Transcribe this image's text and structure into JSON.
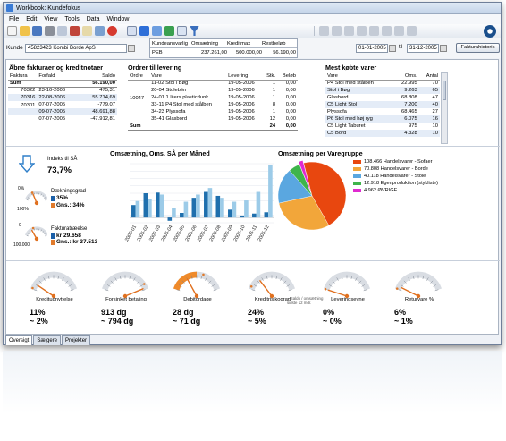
{
  "window": {
    "title": "Workbook: Kundefokus"
  },
  "menu": [
    "File",
    "Edit",
    "View",
    "Tools",
    "Data",
    "Window"
  ],
  "filter": {
    "kunde_label": "Kunde",
    "kunde_value": "45823423 Kombi Borde ApS",
    "date_from": "01-01-2005",
    "date_to_label": "til",
    "date_to": "31-12-2005",
    "history_button": "Fakturahistorik"
  },
  "kpi_strip": {
    "headers": [
      "Kundeansvarlig",
      "Omsætning",
      "Kreditmax",
      "Restbeløb"
    ],
    "values": [
      "PEB",
      "237.261,00",
      "500.000,00",
      "56.190,00"
    ]
  },
  "open_invoices": {
    "title": "Åbne fakturaer og kreditnotaer",
    "columns": [
      "Faktura",
      "Forfald",
      "Saldo"
    ],
    "sum_label": "Sum",
    "sum_value": "56.190,00",
    "rows": [
      [
        "70322",
        "23-10-2006",
        "475,31"
      ],
      [
        "70316",
        "22-08-2006",
        "55.714,69"
      ],
      [
        "70301",
        "07-07-2005",
        "-779,07"
      ],
      [
        "",
        "09-07-2005",
        "48.691,88"
      ],
      [
        "",
        "07-07-2005",
        "-47.912,81"
      ]
    ]
  },
  "orders": {
    "title": "Ordrer til levering",
    "columns": [
      "Ordre",
      "Vare",
      "Levering",
      "Stk.",
      "Beløb"
    ],
    "order_no": "10047",
    "rows": [
      [
        "11-02",
        "Stol i Bøg",
        "19-05-2006",
        "1",
        "0,00"
      ],
      [
        "20-04",
        "Stolebén",
        "19-05-2006",
        "1",
        "0,00"
      ],
      [
        "24-01",
        "1 liters plasticdunk",
        "19-05-2006",
        "1",
        "0,00"
      ],
      [
        "33-11",
        "P4 Stol med stålben",
        "19-05-2006",
        "8",
        "0,00"
      ],
      [
        "34-23",
        "Plyssofa",
        "19-05-2006",
        "1",
        "0,00"
      ],
      [
        "35-41",
        "Glasbord",
        "19-05-2006",
        "12",
        "0,00"
      ]
    ],
    "sum_label": "Sum",
    "sum_qty": "24",
    "sum_amount": "0,00"
  },
  "top_items": {
    "title": "Mest købte varer",
    "columns": [
      "Vare",
      "Oms.",
      "Antal"
    ],
    "rows": [
      [
        "P4 Stol med stålben",
        "22.995",
        "70"
      ],
      [
        "Stol i Bøg",
        "9.263",
        "65"
      ],
      [
        "Glasbord",
        "68.808",
        "47"
      ],
      [
        "C5 Light Stol",
        "7.200",
        "40"
      ],
      [
        "Plyssofa",
        "68.465",
        "27"
      ],
      [
        "P6 Stol med høj ryg",
        "6.075",
        "16"
      ],
      [
        "C5 Light Taburet",
        "975",
        "10"
      ],
      [
        "C5 Bord",
        "4.328",
        "10"
      ]
    ]
  },
  "index": {
    "label": "Indeks til SÅ",
    "value": "73,7%"
  },
  "coverage": {
    "title": "Dækningsgrad",
    "value1": "35%",
    "value2": "Gns.: 34%",
    "scale_min": "0%",
    "scale_max": "100%",
    "fraction": 0.35,
    "avg_fraction": 0.34,
    "color1": "#1a5fa8",
    "color2": "#e07a2b"
  },
  "balance": {
    "title": "Fakturatræelse",
    "value1": "kr 29.658",
    "value2": "Gns.: kr 37.513",
    "scale_min": "0",
    "scale_max": "100.000",
    "fraction": 0.297,
    "avg_fraction": 0.375
  },
  "chart_data": [
    {
      "type": "bar",
      "title": "Omsætning, Oms. SÅ per Måned",
      "categories": [
        "2005-01",
        "2005-02",
        "2005-03",
        "2005-04",
        "2005-05",
        "2005-06",
        "2005-07",
        "2005-08",
        "2005-09",
        "2005-10",
        "2005-11",
        "2005-12"
      ],
      "series": [
        {
          "values": [
            19,
            37,
            38,
            -5,
            7,
            30,
            39,
            33,
            12,
            3,
            6,
            8
          ],
          "color": "#1f6fad"
        },
        {
          "values": [
            25,
            28,
            35,
            15,
            24,
            35,
            45,
            30,
            24,
            26,
            39,
            80
          ],
          "color": "#9ccbe8"
        }
      ],
      "ylim": [
        -8,
        82
      ]
    },
    {
      "type": "pie",
      "title": "Omsætning per Varegruppe",
      "slices": [
        {
          "label": "108.466 Handelsvarer - Sofaer",
          "value": 108466,
          "color": "#e8470f"
        },
        {
          "label": "70.808 Handelsvarer - Borde",
          "value": 70808,
          "color": "#f2a63a"
        },
        {
          "label": "40.118 Handelsvarer - Stole",
          "value": 40118,
          "color": "#5aa7e0"
        },
        {
          "label": "12.918 Egenproduktion (stykliste)",
          "value": 12918,
          "color": "#3fb44b"
        },
        {
          "label": "4.962 ØVRIGE",
          "value": 4962,
          "color": "#e02ad0"
        }
      ]
    }
  ],
  "gauges": [
    {
      "label": "Kreditudnyttelse",
      "value": "11%",
      "avg": "~ 2%",
      "fraction": 0.11,
      "avg_fraction": 0.02,
      "highlight": false
    },
    {
      "label": "Forsinket betaling",
      "value": "913 dg",
      "avg": "~ 794 dg",
      "fraction": 0.97,
      "avg_fraction": 0.9,
      "highlight": false
    },
    {
      "label": "Debitordage",
      "value": "28 dg",
      "avg": "~ 71 dg",
      "fraction": 0.3,
      "avg_fraction": 0.62,
      "highlight": true
    },
    {
      "label": "Kreditrisikograd",
      "value": "24%",
      "avg": "~ 5%",
      "fraction": 0.24,
      "avg_fraction": 0.05,
      "highlight": false,
      "note": "~ Saldo / omsætning sidste 12 mdr."
    },
    {
      "label": "Leveringsevne",
      "value": "0%",
      "avg": "~ 0%",
      "fraction": 0.0,
      "avg_fraction": 0.0,
      "highlight": false
    },
    {
      "label": "Returvare %",
      "value": "6%",
      "avg": "~ 1%",
      "fraction": 0.06,
      "avg_fraction": 0.01,
      "highlight": false
    }
  ],
  "tabs": [
    "Oversigt",
    "Sælgere",
    "Projekter"
  ]
}
